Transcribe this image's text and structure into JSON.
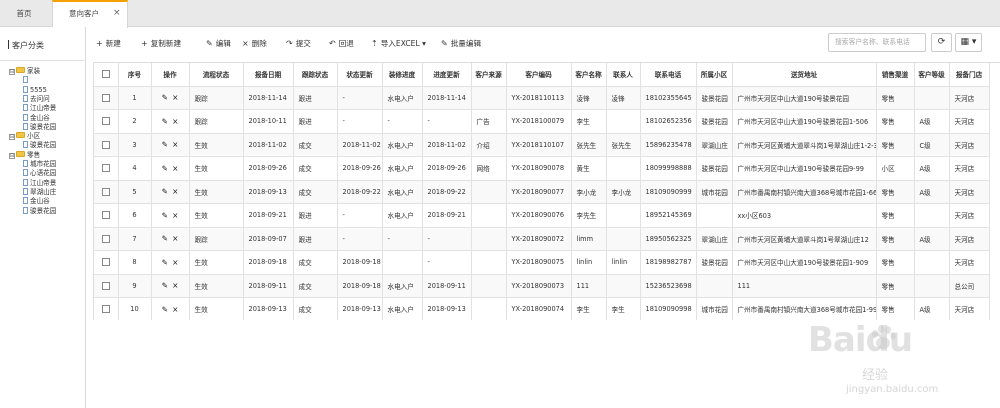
{
  "tabs": [
    {
      "label": "首页"
    },
    {
      "label": "意向客户",
      "close": "×"
    }
  ],
  "sidebar": {
    "title": "客户分类",
    "tree": [
      {
        "label": "家装",
        "type": "folder",
        "toggle": "⊟",
        "level": 0
      },
      {
        "label": "",
        "type": "doc",
        "level": 1
      },
      {
        "label": "5555",
        "type": "doc",
        "level": 1
      },
      {
        "label": "去问问",
        "type": "doc",
        "level": 1
      },
      {
        "label": "江山帝景",
        "type": "doc",
        "level": 1
      },
      {
        "label": "金山谷",
        "type": "doc",
        "level": 1
      },
      {
        "label": "骏景花园",
        "type": "doc",
        "level": 1
      },
      {
        "label": "小区",
        "type": "folder",
        "toggle": "⊟",
        "level": 0
      },
      {
        "label": "骏景花园",
        "type": "doc",
        "level": 1
      },
      {
        "label": "零售",
        "type": "folder",
        "toggle": "⊟",
        "level": 0
      },
      {
        "label": "城市花园",
        "type": "doc",
        "level": 1
      },
      {
        "label": "心语花园",
        "type": "doc",
        "level": 1
      },
      {
        "label": "江山帝景",
        "type": "doc",
        "level": 1
      },
      {
        "label": "翠湖山庄",
        "type": "doc",
        "level": 1
      },
      {
        "label": "金山谷",
        "type": "doc",
        "level": 1
      },
      {
        "label": "骏景花园",
        "type": "doc",
        "level": 1
      }
    ]
  },
  "toolbar": {
    "buttons": [
      {
        "icon": "+",
        "label": "新建"
      },
      {
        "icon": "+",
        "label": "复制新建"
      },
      {
        "icon": "✎",
        "label": "编辑"
      },
      {
        "icon": "×",
        "label": "删除"
      },
      {
        "icon": "↷",
        "label": "提交"
      },
      {
        "icon": "↶",
        "label": "回退"
      },
      {
        "icon": "⇡",
        "label": "导入EXCEL ▾"
      },
      {
        "icon": "✎",
        "label": "批量编辑"
      }
    ],
    "search_placeholder": "搜索客户名称、联系电话",
    "refresh_icon": "⟳",
    "columns_icon": "▦ ▾"
  },
  "table": {
    "columns": [
      "",
      "序号",
      "操作",
      "流程状态",
      "报备日期",
      "跟踪状态",
      "状态更新",
      "装修进度",
      "进度更新",
      "客户来源",
      "客户编码",
      "客户名称",
      "联系人",
      "联系电话",
      "所属小区",
      "送货地址",
      "销售渠道",
      "客户等级",
      "报备门店"
    ],
    "rows": [
      [
        "1",
        "跟踪",
        "2018-11-14",
        "跟进",
        "-",
        "水电入户",
        "2018-11-14",
        "",
        "YX-2018110113",
        "凌锋",
        "凌锋",
        "18102355645",
        "骏景花园",
        "广州市天河区中山大道190号骏景花园",
        "零售",
        "",
        "天河店"
      ],
      [
        "2",
        "跟踪",
        "2018-10-11",
        "跟进",
        "-",
        "-",
        "-",
        "广告",
        "YX-2018100079",
        "李生",
        "",
        "18102652356",
        "骏景花园",
        "广州市天河区中山大道190号骏景花园1-506",
        "零售",
        "A级",
        "天河店"
      ],
      [
        "3",
        "生效",
        "2018-11-02",
        "成交",
        "2018-11-02",
        "水电入户",
        "2018-11-02",
        "介绍",
        "YX-2018110107",
        "张先生",
        "张先生",
        "15896235478",
        "翠湖山庄",
        "广州市天河区黄埔大道翠斗岗1号翠湖山庄1-2-302",
        "零售",
        "C级",
        "天河店"
      ],
      [
        "4",
        "生效",
        "2018-09-26",
        "成交",
        "2018-09-26",
        "水电入户",
        "2018-09-26",
        "网络",
        "YX-2018090078",
        "黄生",
        "",
        "18099998888",
        "骏景花园",
        "广州市天河区中山大道190号骏景花园9-99",
        "小区",
        "A级",
        "天河店"
      ],
      [
        "5",
        "生效",
        "2018-09-13",
        "成交",
        "2018-09-22",
        "水电入户",
        "2018-09-22",
        "",
        "YX-2018090077",
        "李小龙",
        "李小龙",
        "18109090999",
        "城市花园",
        "广州市番禺南村镇兴南大道368号城市花园1-666",
        "零售",
        "A级",
        "天河店"
      ],
      [
        "6",
        "生效",
        "2018-09-21",
        "跟进",
        "-",
        "水电入户",
        "2018-09-21",
        "",
        "YX-2018090076",
        "李先生",
        "",
        "18952145369",
        "",
        "xx小区603",
        "零售",
        "",
        "天河店"
      ],
      [
        "7",
        "跟踪",
        "2018-09-07",
        "跟进",
        "-",
        "-",
        "-",
        "",
        "YX-2018090072",
        "limm",
        "",
        "18950562325",
        "翠湖山庄",
        "广州市天河区黄埔大道翠斗岗1号翠湖山庄12",
        "零售",
        "A级",
        "天河店"
      ],
      [
        "8",
        "生效",
        "2018-09-18",
        "成交",
        "2018-09-18",
        "",
        "-",
        "",
        "YX-2018090075",
        "linlin",
        "linlin",
        "18198982787",
        "骏景花园",
        "广州市天河区中山大道190号骏景花园1-909",
        "零售",
        "",
        "天河店"
      ],
      [
        "9",
        "生效",
        "2018-09-11",
        "成交",
        "2018-09-18",
        "水电入户",
        "2018-09-11",
        "",
        "YX-2018090073",
        "111",
        "",
        "15236523698",
        "",
        "111",
        "零售",
        "",
        "总公司"
      ],
      [
        "10",
        "生效",
        "2018-09-13",
        "成交",
        "2018-09-13",
        "水电入户",
        "2018-09-13",
        "",
        "YX-2018090074",
        "李生",
        "李生",
        "18109090998",
        "城市花园",
        "广州市番禺南村镇兴南大道368号城市花园1-999",
        "零售",
        "A级",
        "天河店"
      ]
    ],
    "action_edit": "✎",
    "action_delete": "×"
  },
  "watermark": {
    "brand": "Baidu",
    "sub": "经验",
    "url": "jingyan.baidu.com"
  }
}
